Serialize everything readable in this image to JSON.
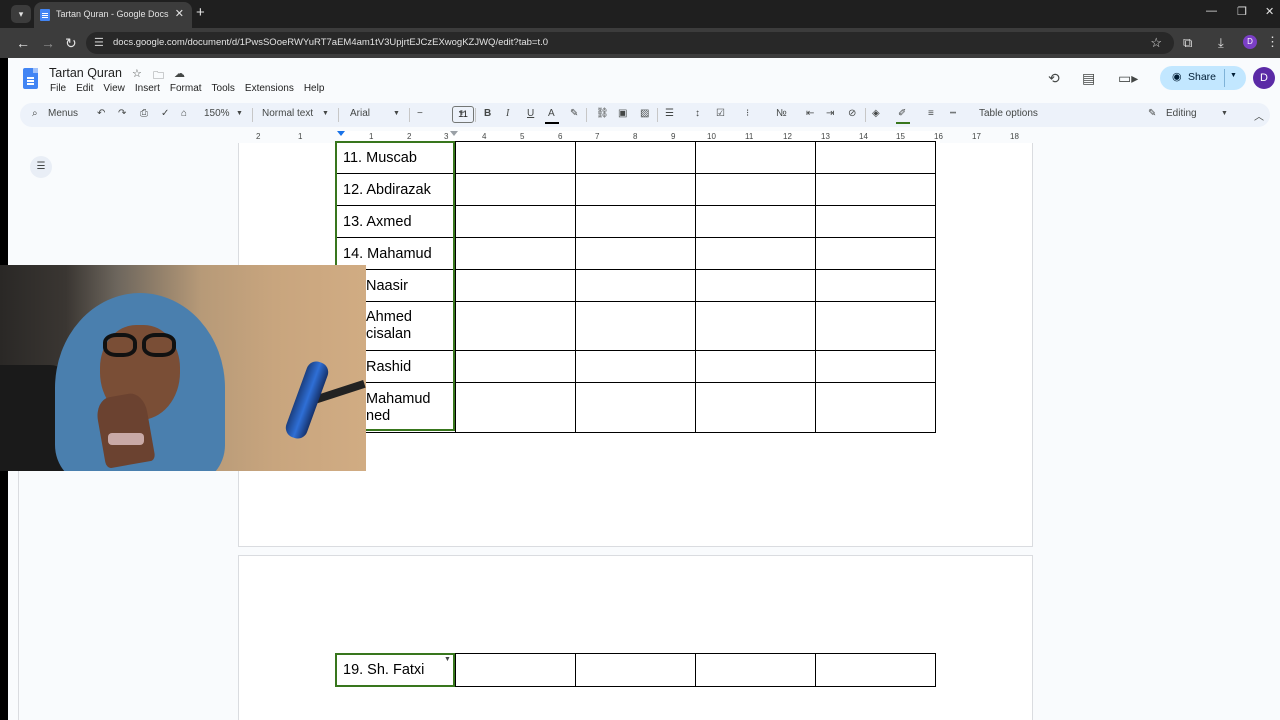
{
  "browser": {
    "tab_title": "Tartan Quran - Google Docs",
    "new_tab": "+",
    "url": "docs.google.com/document/d/1PwsSOoeRWYuRT7aEM4am1tV3UpjrtEJCzEXwogKZJWQ/edit?tab=t.0",
    "profile_initial": "D"
  },
  "docs": {
    "title": "Tartan Quran",
    "menus": [
      "File",
      "Edit",
      "View",
      "Insert",
      "Format",
      "Tools",
      "Extensions",
      "Help"
    ],
    "share_label": "Share",
    "account_initial": "D"
  },
  "toolbar": {
    "search_menus": "Menus",
    "zoom": "150%",
    "style": "Normal text",
    "font": "Arial",
    "font_size": "11",
    "bold": "B",
    "italic": "I",
    "underline": "U",
    "text_color": "A",
    "table_options": "Table options",
    "mode": "Editing"
  },
  "ruler": {
    "numbers": [
      "2",
      "1",
      "1",
      "2",
      "3",
      "4",
      "5",
      "6",
      "7",
      "8",
      "9",
      "10",
      "11",
      "12",
      "13",
      "14",
      "15",
      "16",
      "17",
      "18"
    ]
  },
  "table_page1": {
    "rows": [
      "11. Muscab",
      "12. Abdirazak",
      "13. Axmed",
      "14. Mahamud",
      "Naasir",
      "Ahmed\ncisalan",
      "Rashid",
      "Mahamud\nned"
    ]
  },
  "table_page2": {
    "rows": [
      "19. Sh. Fatxi"
    ]
  },
  "colors": {
    "accent": "#1a73e8",
    "share_bg": "#c2e7ff",
    "selection_border": "#38761d"
  }
}
